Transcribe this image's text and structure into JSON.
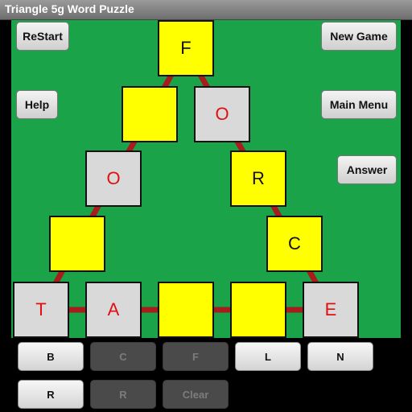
{
  "window": {
    "title": "Triangle 5g Word Puzzle"
  },
  "buttons": {
    "restart": "ReStart",
    "new_game": "New Game",
    "help": "Help",
    "main_menu": "Main Menu",
    "answer": "Answer"
  },
  "tiles": [
    {
      "id": "t0",
      "letter": "F",
      "color": "yellow"
    },
    {
      "id": "t1",
      "letter": "",
      "color": "yellow"
    },
    {
      "id": "t2",
      "letter": "O",
      "color": "gray"
    },
    {
      "id": "t3",
      "letter": "O",
      "color": "gray"
    },
    {
      "id": "t4",
      "letter": "R",
      "color": "yellow"
    },
    {
      "id": "t5",
      "letter": "",
      "color": "yellow"
    },
    {
      "id": "t6",
      "letter": "C",
      "color": "yellow"
    },
    {
      "id": "t7",
      "letter": "T",
      "color": "gray"
    },
    {
      "id": "t8",
      "letter": "A",
      "color": "gray"
    },
    {
      "id": "t9",
      "letter": "",
      "color": "yellow"
    },
    {
      "id": "t10",
      "letter": "",
      "color": "yellow"
    },
    {
      "id": "t11",
      "letter": "E",
      "color": "gray"
    }
  ],
  "keyboard": [
    {
      "label": "B",
      "enabled": true
    },
    {
      "label": "C",
      "enabled": false
    },
    {
      "label": "F",
      "enabled": false
    },
    {
      "label": "L",
      "enabled": true
    },
    {
      "label": "N",
      "enabled": true
    },
    {
      "label": "R",
      "enabled": true
    },
    {
      "label": "R",
      "enabled": false
    },
    {
      "label": "Clear",
      "enabled": false
    }
  ],
  "colors": {
    "board": "#1aa349",
    "tile_yellow": "#ffff00",
    "tile_gray": "#d9d9d9",
    "tile_letter": "#e10f0f",
    "link": "#a81c1c"
  }
}
